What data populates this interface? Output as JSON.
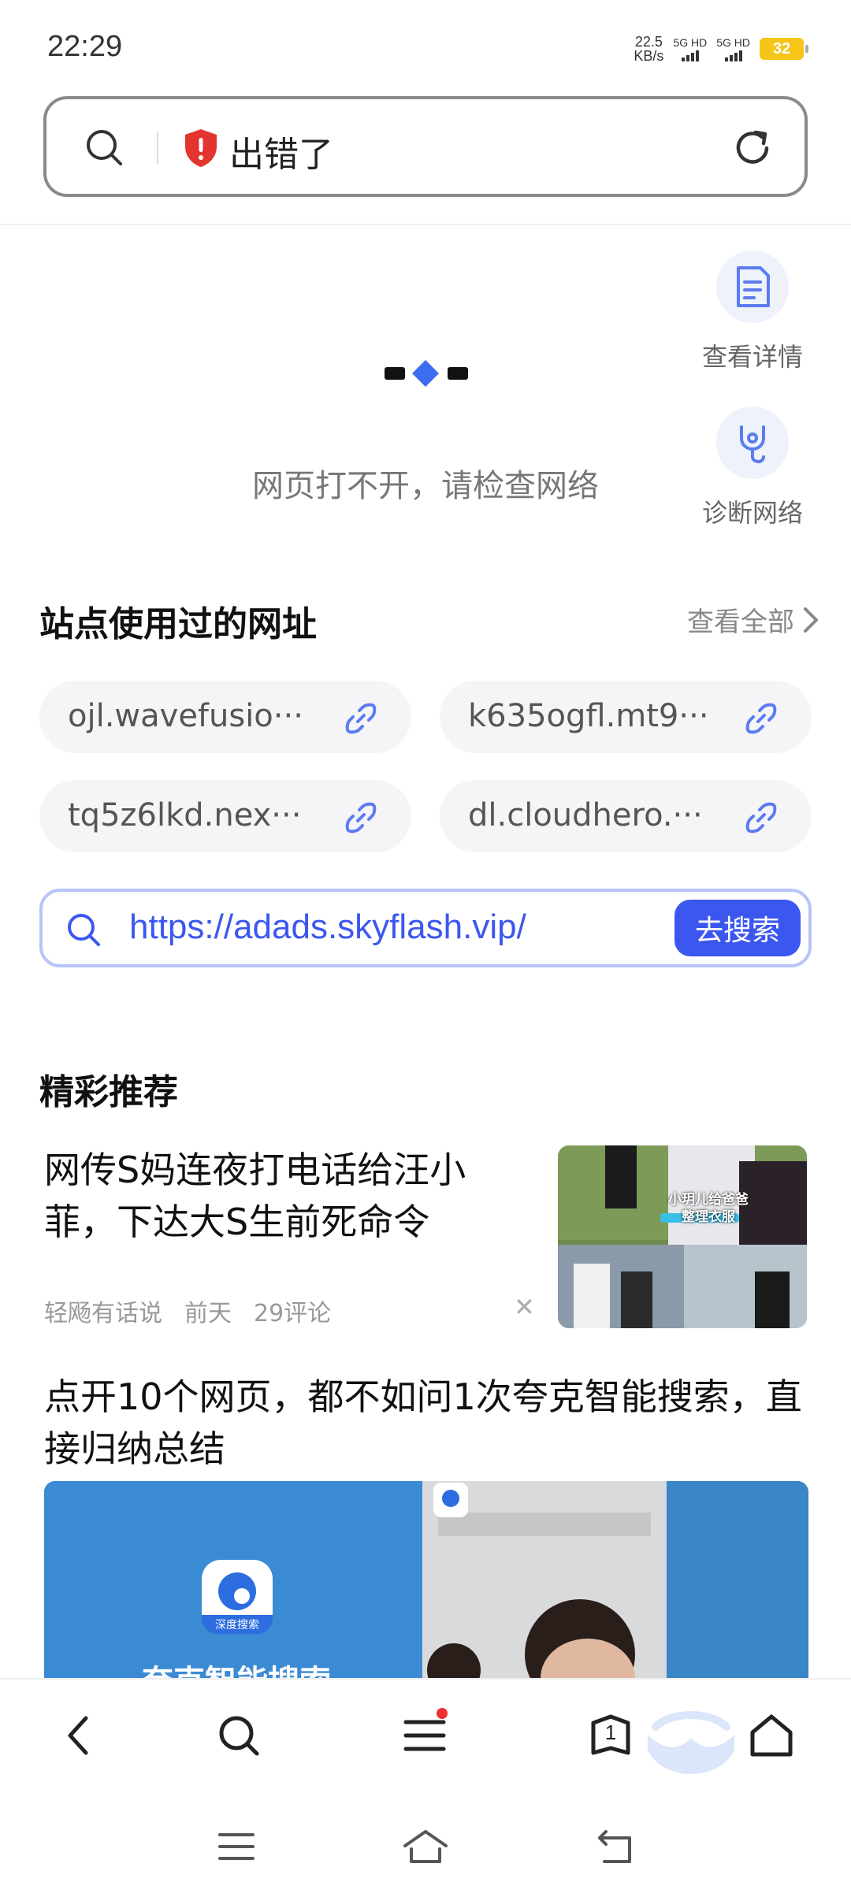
{
  "status_bar": {
    "time": "22:29",
    "net_speed_value": "22.5",
    "net_speed_unit": "KB/s",
    "sim1_label": "5G HD",
    "sim2_label": "5G HD",
    "battery_level": "32"
  },
  "address_bar": {
    "title": "出错了",
    "search_icon": "search-icon",
    "status_icon": "shield-alert-icon",
    "reload_icon": "refresh-icon"
  },
  "error_page": {
    "message": "网页打不开，请检查网络",
    "tools": [
      {
        "label": "查看详情",
        "icon": "document-icon"
      },
      {
        "label": "诊断网络",
        "icon": "stethoscope-icon"
      }
    ]
  },
  "used_urls": {
    "title": "站点使用过的网址",
    "view_all": "查看全部",
    "items": [
      "ojl.wavefusio···",
      "k635ogfl.mt9···",
      "tq5z6lkd.nex···",
      "dl.cloudhero.···"
    ]
  },
  "search": {
    "query": "https://adads.skyflash.vip/",
    "button": "去搜索"
  },
  "feed": {
    "title": "精彩推荐",
    "articles": [
      {
        "title": "网传S妈连夜打电话给汪小菲，下达大S生前死命令",
        "source": "轻飏有话说",
        "time": "前天",
        "comments": "29评论",
        "thumb_caption": "小玥儿给爸爸整理衣服"
      },
      {
        "title": "点开10个网页，都不如问1次夸克智能搜索，直接归纳总结",
        "banner_caption": "深度搜索",
        "banner_text": "夸克智能搜索"
      }
    ]
  },
  "toolbar": {
    "back": "back-icon",
    "search": "search-icon",
    "menu": "menu-icon",
    "tab_count": "1",
    "home": "home-icon"
  },
  "colors": {
    "accent": "#3c57f0",
    "error_red": "#e3342f",
    "border_gray": "#8a8a8a",
    "chip_bg": "#f5f5f7",
    "icon_bg": "#eef2fb"
  }
}
